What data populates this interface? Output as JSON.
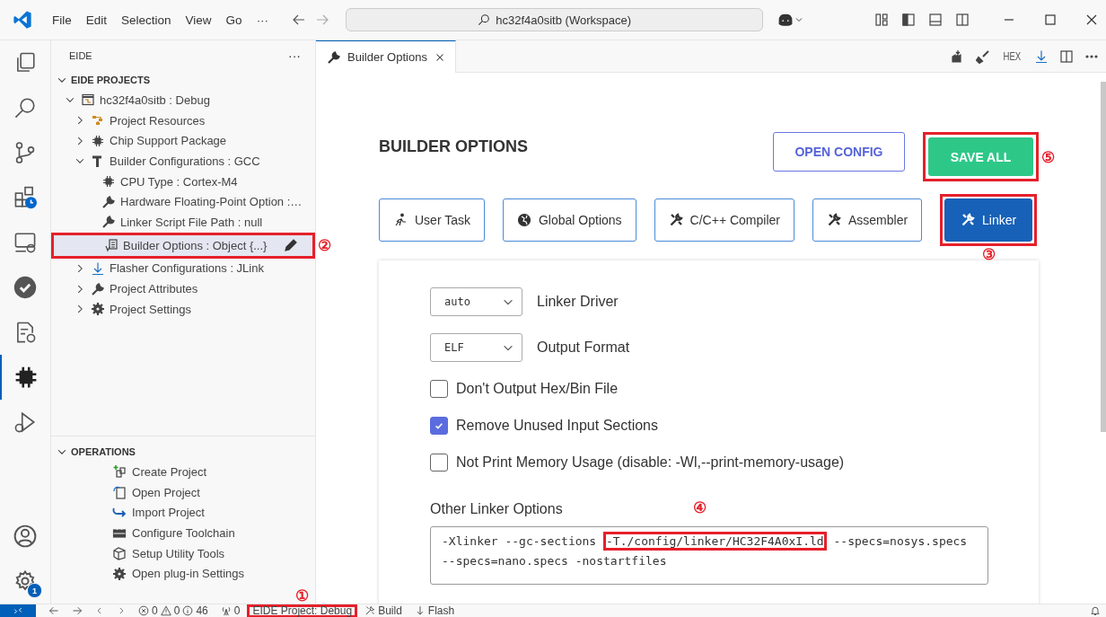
{
  "title_bar": {
    "menu": [
      "File",
      "Edit",
      "Selection",
      "View",
      "Go",
      "···"
    ],
    "search": "hc32f4a0sitb (Workspace)"
  },
  "activity_bar": {
    "items": [
      {
        "selected": false
      },
      {
        "selected": false
      },
      {
        "selected": false
      },
      {
        "selected": false
      },
      {
        "selected": false
      },
      {
        "selected": false
      },
      {
        "selected": false
      },
      {
        "selected": true
      },
      {
        "selected": false
      }
    ],
    "settings_badge": "1"
  },
  "sidebar": {
    "title": "EIDE",
    "more": "···",
    "projects": {
      "title": "EIDE PROJECTS",
      "expanded": true,
      "tree": [
        {
          "label": "hc32f4a0sitb : Debug",
          "expanded": true,
          "selected": false,
          "children": [
            {
              "label": "Project Resources",
              "expanded": false,
              "selected": false
            },
            {
              "label": "Chip Support Package",
              "expanded": false,
              "selected": false
            },
            {
              "label": "Builder Configurations : GCC",
              "expanded": true,
              "selected": false,
              "children": [
                {
                  "label": "CPU Type : Cortex-M4",
                  "selected": false
                },
                {
                  "label": "Hardware Floating-Point Option :…",
                  "selected": false
                },
                {
                  "label": "Linker Script File Path : null",
                  "selected": false
                },
                {
                  "label": "Builder Options : Object {...}",
                  "selected": true,
                  "callout": "②"
                }
              ]
            },
            {
              "label": "Flasher Configurations : JLink",
              "expanded": false,
              "selected": false
            },
            {
              "label": "Project Attributes",
              "expanded": false,
              "selected": false
            },
            {
              "label": "Project Settings",
              "expanded": false,
              "selected": false
            }
          ]
        }
      ]
    },
    "operations": {
      "title": "OPERATIONS",
      "expanded": true,
      "items": [
        "Create Project",
        "Open Project",
        "Import Project",
        "Configure Toolchain",
        "Setup Utility Tools",
        "Open plug-in Settings"
      ]
    }
  },
  "editor": {
    "tab": {
      "label": "Builder Options",
      "selected": true
    },
    "toolbar_text": "HEX"
  },
  "page": {
    "heading": "BUILDER OPTIONS",
    "open_config": "OPEN CONFIG",
    "save_all": {
      "label": "SAVE ALL",
      "callout": "⑤"
    },
    "tabs": [
      {
        "label": "User Task",
        "selected": false
      },
      {
        "label": "Global Options",
        "selected": false
      },
      {
        "label": "C/C++ Compiler",
        "selected": false
      },
      {
        "label": "Assembler",
        "selected": false
      },
      {
        "label": "Linker",
        "selected": true,
        "callout": "③"
      }
    ],
    "selects": [
      {
        "value": "auto",
        "label": "Linker Driver"
      },
      {
        "value": "ELF",
        "label": "Output Format"
      }
    ],
    "checkboxes": [
      {
        "label": "Don't Output Hex/Bin File",
        "checked": false
      },
      {
        "label": "Remove Unused Input Sections",
        "checked": true
      },
      {
        "label": "Not Print Memory Usage (disable: -Wl,--print-memory-usage)",
        "checked": false
      }
    ],
    "other_options": {
      "label": "Other Linker Options",
      "value_parts": [
        {
          "text": "-Xlinker --gc-sections "
        },
        {
          "text": "-T./config/linker/HC32F4A0xI.ld",
          "callout": "④"
        },
        {
          "text": " --specs=nosys.specs --specs=nano.specs -nostartfiles"
        }
      ]
    }
  },
  "status_bar": {
    "errors": "0",
    "warnings": "0",
    "infos": "46",
    "ports": "0",
    "project": {
      "label": "EIDE Project: Debug",
      "callout": "①"
    },
    "build": "Build",
    "flash": "Flash"
  }
}
